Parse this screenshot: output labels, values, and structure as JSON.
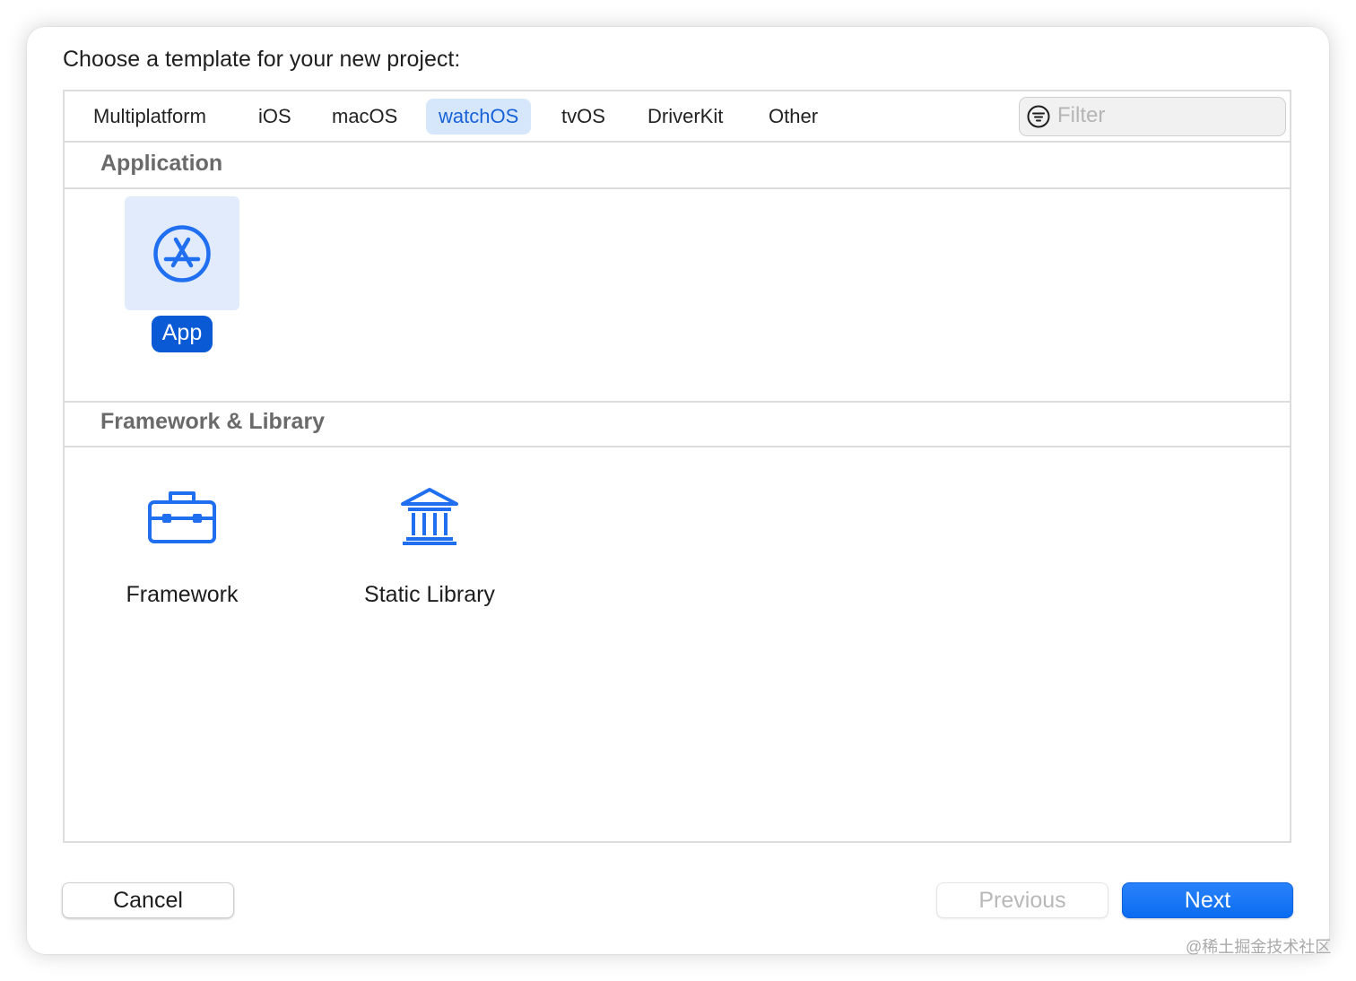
{
  "dialog": {
    "title": "Choose a template for your new project:"
  },
  "tabs": [
    {
      "label": "Multiplatform",
      "active": false
    },
    {
      "label": "iOS",
      "active": false
    },
    {
      "label": "macOS",
      "active": false
    },
    {
      "label": "watchOS",
      "active": true
    },
    {
      "label": "tvOS",
      "active": false
    },
    {
      "label": "DriverKit",
      "active": false
    },
    {
      "label": "Other",
      "active": false
    }
  ],
  "filter": {
    "placeholder": "Filter",
    "value": "",
    "icon": "filter-icon"
  },
  "sections": [
    {
      "title": "Application",
      "templates": [
        {
          "label": "App",
          "icon": "app-store-icon",
          "selected": true
        }
      ]
    },
    {
      "title": "Framework & Library",
      "templates": [
        {
          "label": "Framework",
          "icon": "toolbox-icon",
          "selected": false
        },
        {
          "label": "Static Library",
          "icon": "library-icon",
          "selected": false
        }
      ]
    }
  ],
  "buttons": {
    "cancel": "Cancel",
    "previous": "Previous",
    "next": "Next"
  },
  "colors": {
    "accent": "#0a6cf0",
    "selected_tab_bg": "#d7e7fb",
    "selected_tile_bg": "#e1ebfb",
    "icon_blue": "#1f6ff0"
  },
  "watermark": "@稀土掘金技术社区"
}
